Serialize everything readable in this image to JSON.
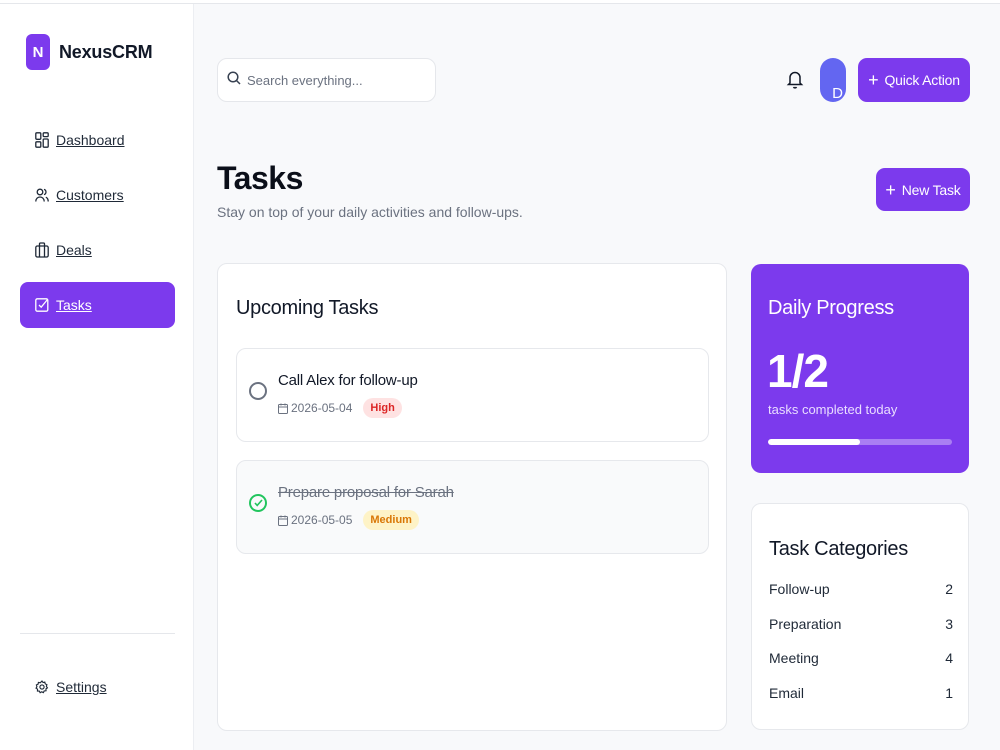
{
  "brand": {
    "logo_letter": "N",
    "name": "NexusCRM",
    "color": "#7c3aed"
  },
  "sidebar": {
    "items": [
      {
        "label": "Dashboard",
        "icon": "dashboard-icon"
      },
      {
        "label": "Customers",
        "icon": "users-icon"
      },
      {
        "label": "Deals",
        "icon": "briefcase-icon"
      },
      {
        "label": "Tasks",
        "icon": "checkbox-icon",
        "active": true
      }
    ],
    "settings_label": "Settings"
  },
  "header": {
    "search_placeholder": "Search everything...",
    "avatar_initial": "D",
    "quick_action_label": "Quick Action"
  },
  "page": {
    "title": "Tasks",
    "subtitle": "Stay on top of your daily activities and follow-ups.",
    "new_task_label": "New Task"
  },
  "upcoming": {
    "title": "Upcoming Tasks",
    "tasks": [
      {
        "title": "Call Alex for follow-up",
        "date": "2026-05-04",
        "priority": "High",
        "done": false
      },
      {
        "title": "Prepare proposal for Sarah",
        "date": "2026-05-05",
        "priority": "Medium",
        "done": true
      }
    ]
  },
  "progress": {
    "title": "Daily Progress",
    "value": "1/2",
    "caption": "tasks completed today",
    "fraction": 0.5
  },
  "categories": {
    "title": "Task Categories",
    "items": [
      {
        "label": "Follow-up",
        "count": "2"
      },
      {
        "label": "Preparation",
        "count": "3"
      },
      {
        "label": "Meeting",
        "count": "4"
      },
      {
        "label": "Email",
        "count": "1"
      }
    ]
  }
}
